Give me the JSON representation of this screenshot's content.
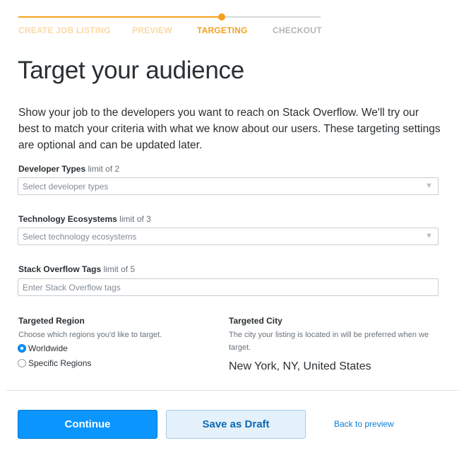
{
  "stepper": {
    "steps": [
      {
        "label": "CREATE JOB LISTING",
        "state": "done"
      },
      {
        "label": "PREVIEW",
        "state": "done"
      },
      {
        "label": "TARGETING",
        "state": "active"
      },
      {
        "label": "CHECKOUT",
        "state": "todo"
      }
    ]
  },
  "page": {
    "title": "Target your audience",
    "intro": "Show your job to the developers you want to reach on Stack Overflow. We'll try our best to match your criteria with what we know about our users. These targeting settings are optional and can be updated later."
  },
  "developer_types": {
    "label": "Developer Types",
    "limit": "limit of 2",
    "placeholder": "Select developer types"
  },
  "technology_ecosystems": {
    "label": "Technology Ecosystems",
    "limit": "limit of 3",
    "placeholder": "Select technology ecosystems"
  },
  "tags": {
    "label": "Stack Overflow Tags",
    "limit": "limit of 5",
    "placeholder": "Enter Stack Overflow tags",
    "value": ""
  },
  "region": {
    "title": "Targeted Region",
    "description": "Choose which regions you'd like to target.",
    "options": [
      {
        "label": "Worldwide",
        "selected": true
      },
      {
        "label": "Specific Regions",
        "selected": false
      }
    ]
  },
  "city": {
    "title": "Targeted City",
    "description": "The city your listing is located in will be preferred when we target.",
    "value": "New York, NY, United States"
  },
  "actions": {
    "continue_label": "Continue",
    "draft_label": "Save as Draft",
    "back_label": "Back to preview"
  },
  "colors": {
    "accent": "#f4a11a",
    "primary": "#0a95ff",
    "link": "#0c7bd1"
  }
}
